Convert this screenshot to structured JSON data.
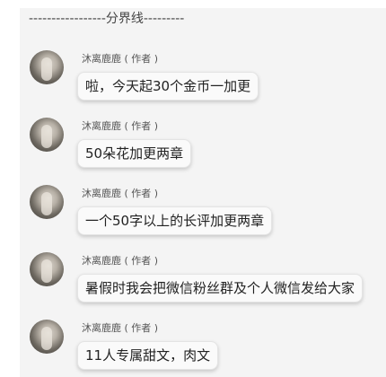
{
  "divider": {
    "text": "-----------------分界线---------"
  },
  "messages": [
    {
      "author": "沐离鹿鹿 ( 作者 )",
      "text": "啦，今天起30个金币一加更"
    },
    {
      "author": "沐离鹿鹿 ( 作者 )",
      "text": "50朵花加更两章"
    },
    {
      "author": "沐离鹿鹿 ( 作者 )",
      "text": "一个50字以上的长评加更两章"
    },
    {
      "author": "沐离鹿鹿 ( 作者 )",
      "text": "暑假时我会把微信粉丝群及个人微信发给大家"
    },
    {
      "author": "沐离鹿鹿 ( 作者 )",
      "text": "11人专属甜文，肉文"
    }
  ],
  "colors": {
    "panel_bg": "#f4f4f4",
    "bubble_bg": "#fafafa",
    "text": "#222222"
  }
}
